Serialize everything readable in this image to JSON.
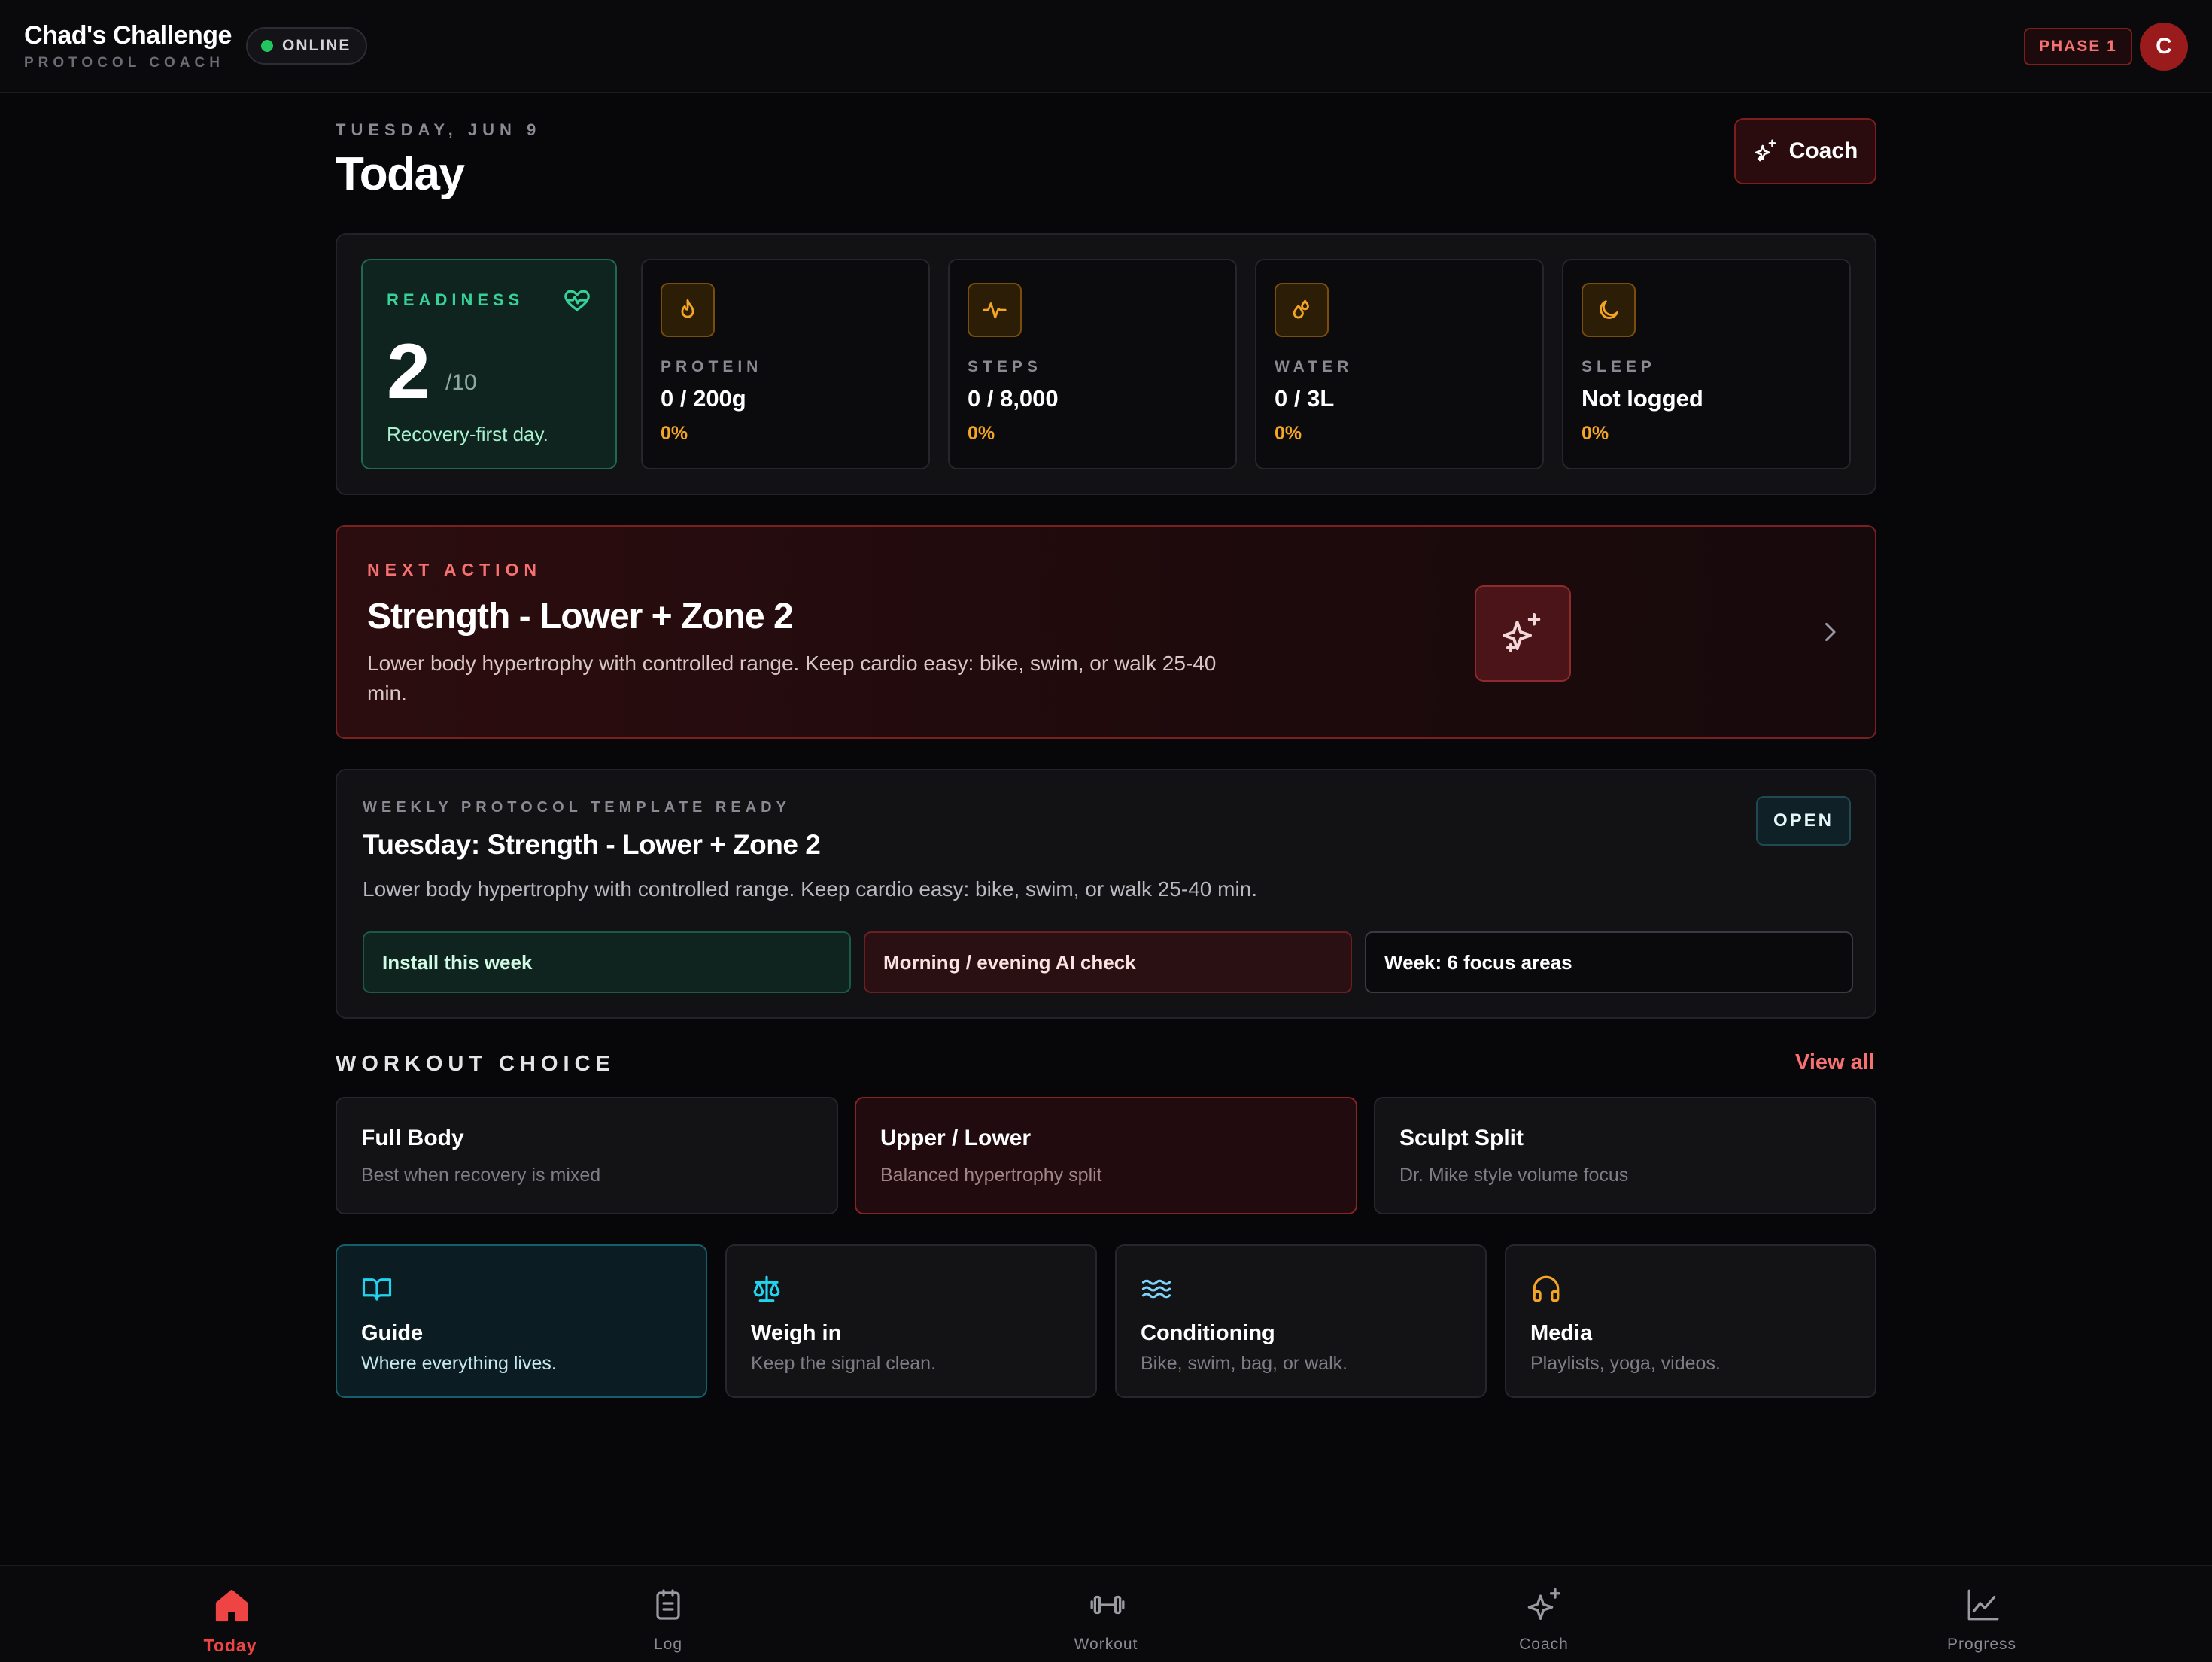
{
  "colors": {
    "background": "#070709",
    "accent_red": "#ef4444",
    "accent_green": "#34d399",
    "accent_amber": "#f5a524",
    "accent_teal": "#22d3ee",
    "online": "#22c55e"
  },
  "header": {
    "app_title": "Chad's Challenge",
    "app_subtitle": "PROTOCOL COACH",
    "status_label": "ONLINE",
    "phase_label": "PHASE 1",
    "avatar_initial": "C"
  },
  "page": {
    "date_label": "TUESDAY, JUN 9",
    "title": "Today",
    "coach_button_label": "Coach",
    "coach_button_icon": "sparkles-icon"
  },
  "readiness": {
    "label": "READINESS",
    "icon": "heart-pulse-icon",
    "score": "2",
    "max": "/10",
    "note": "Recovery-first day."
  },
  "stats": [
    {
      "label": "PROTEIN",
      "value": "0 / 200g",
      "percent": "0%",
      "icon": "flame-icon"
    },
    {
      "label": "STEPS",
      "value": "0 / 8,000",
      "percent": "0%",
      "icon": "activity-icon"
    },
    {
      "label": "WATER",
      "value": "0 / 3L",
      "percent": "0%",
      "icon": "droplets-icon"
    },
    {
      "label": "SLEEP",
      "value": "Not logged",
      "percent": "0%",
      "icon": "moon-icon"
    }
  ],
  "next_action": {
    "label": "NEXT ACTION",
    "title": "Strength - Lower + Zone 2",
    "description": "Lower body hypertrophy with controlled range. Keep cardio easy: bike, swim, or walk 25-40 min.",
    "icon": "sparkles-icon"
  },
  "weekly_template": {
    "label": "WEEKLY PROTOCOL TEMPLATE READY",
    "title": "Tuesday: Strength - Lower + Zone 2",
    "description": "Lower body hypertrophy with controlled range. Keep cardio easy: bike, swim, or walk 25-40 min.",
    "open_label": "OPEN",
    "chips": [
      {
        "label": "Install this week"
      },
      {
        "label": "Morning / evening AI check"
      },
      {
        "label": "Week: 6 focus areas"
      }
    ]
  },
  "workout_choice": {
    "section_title": "WORKOUT CHOICE",
    "view_all_label": "View all",
    "options": [
      {
        "title": "Full Body",
        "subtitle": "Best when recovery is mixed",
        "selected": false
      },
      {
        "title": "Upper / Lower",
        "subtitle": "Balanced hypertrophy split",
        "selected": true
      },
      {
        "title": "Sculpt Split",
        "subtitle": "Dr. Mike style volume focus",
        "selected": false
      }
    ]
  },
  "tiles": [
    {
      "title": "Guide",
      "subtitle": "Where everything lives.",
      "icon": "book-open-icon"
    },
    {
      "title": "Weigh in",
      "subtitle": "Keep the signal clean.",
      "icon": "scale-icon"
    },
    {
      "title": "Conditioning",
      "subtitle": "Bike, swim, bag, or walk.",
      "icon": "waves-icon"
    },
    {
      "title": "Media",
      "subtitle": "Playlists, yoga, videos.",
      "icon": "headphones-icon"
    }
  ],
  "bottom_nav": {
    "items": [
      {
        "label": "Today",
        "icon": "home-icon",
        "active": true
      },
      {
        "label": "Log",
        "icon": "clipboard-icon",
        "active": false
      },
      {
        "label": "Workout",
        "icon": "dumbbell-icon",
        "active": false
      },
      {
        "label": "Coach",
        "icon": "sparkles-icon",
        "active": false
      },
      {
        "label": "Progress",
        "icon": "line-chart-icon",
        "active": false
      }
    ]
  }
}
